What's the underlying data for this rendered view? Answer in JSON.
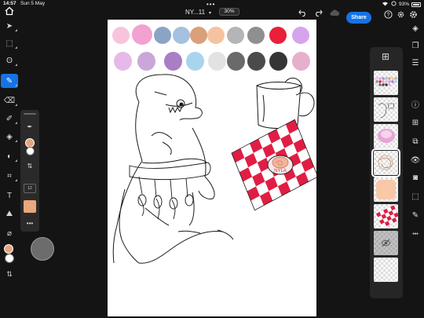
{
  "status": {
    "time": "14:57",
    "date": "Sun 5 May",
    "battery": "93%"
  },
  "header": {
    "doc_title": "NY...11",
    "zoom": "30%",
    "share_label": "Share"
  },
  "icons": {
    "home": "home-icon",
    "undo": "undo-icon",
    "redo": "redo-icon",
    "cloud": "cloud-icon",
    "help": "help-icon",
    "settings": "gear-icon"
  },
  "left_tools": [
    {
      "name": "select-tool",
      "glyph": "➤"
    },
    {
      "name": "transform-tool",
      "glyph": "⬚"
    },
    {
      "name": "lasso-tool",
      "glyph": "ʘ"
    },
    {
      "name": "brush-tool",
      "glyph": "✎"
    },
    {
      "name": "eraser-tool",
      "glyph": "⌫"
    },
    {
      "name": "smudge-tool",
      "glyph": "✐"
    },
    {
      "name": "fill-tool",
      "glyph": "◈"
    },
    {
      "name": "adjust-tool",
      "glyph": "◐"
    },
    {
      "name": "crop-tool",
      "glyph": "⌗"
    },
    {
      "name": "text-tool",
      "glyph": "T"
    },
    {
      "name": "place-image-tool",
      "glyph": "⛰"
    },
    {
      "name": "eyedropper-tool",
      "glyph": "⌀"
    }
  ],
  "brush_panel": {
    "size_label": "12"
  },
  "colors": {
    "accent": "#1473e6",
    "foreground": "#e7a47a",
    "background": "#ffffff",
    "brush_swatch": "#e8a77c"
  },
  "palette": {
    "row1": [
      "#f7c4dc",
      "#f2a1d0",
      "#8aa4c6",
      "#a6c0e0",
      "#d9a079",
      "#f6c3a0",
      "#b5b5b5",
      "#8f8f8f",
      "#e8203a",
      "#d6a4ec"
    ],
    "row2": [
      "#e7b9e8",
      "#c9a7d8",
      "#aa7ec4",
      "#a8d4ee",
      "#e2e2e2",
      "#6a6a6a",
      "#4b4b4b",
      "#353535",
      "#e6b0cc"
    ]
  },
  "tablecloth_text": "NYLA",
  "right_rail": [
    "layers-icon",
    "stack-icon",
    "sliders-icon",
    "info-icon",
    "add-layer-icon",
    "adjust-layer-icon",
    "visibility-icon",
    "mask-icon",
    "clipping-icon",
    "brush-settings-icon",
    "more-icon"
  ]
}
